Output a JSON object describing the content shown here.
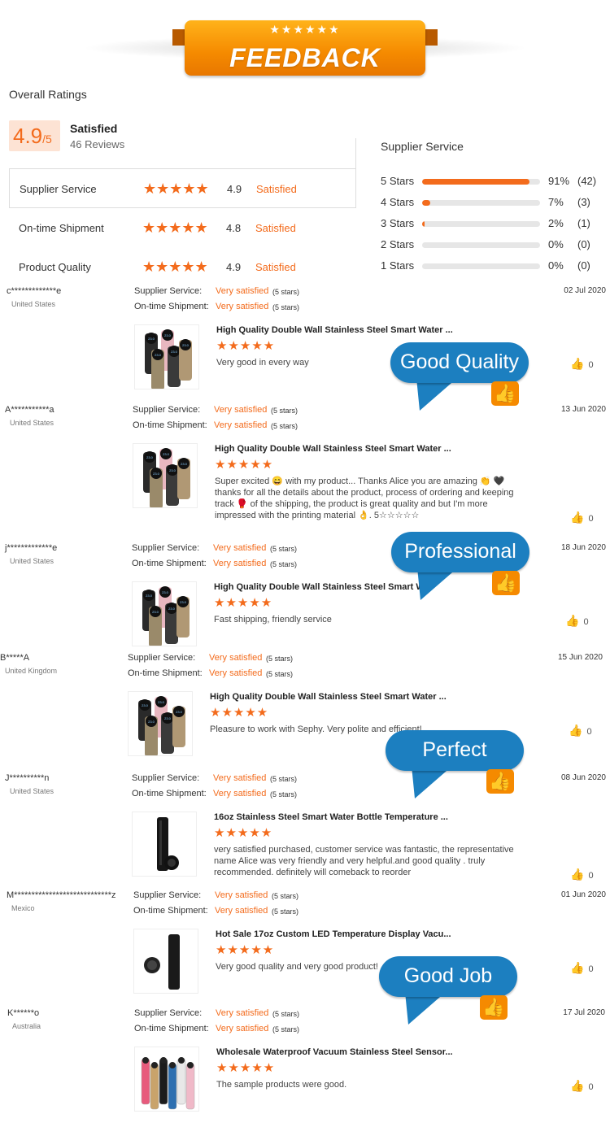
{
  "banner": {
    "stars": "★★★★★★",
    "title": "FEEDBACK"
  },
  "overall": {
    "label": "Overall Ratings",
    "score": "4.9",
    "score_suffix": "/5",
    "status": "Satisfied",
    "reviews": "46 Reviews",
    "categories": [
      {
        "name": "Supplier Service",
        "stars": "★★★★★",
        "score": "4.9",
        "status": "Satisfied"
      },
      {
        "name": "On-time Shipment",
        "stars": "★★★★★",
        "score": "4.8",
        "status": "Satisfied"
      },
      {
        "name": "Product Quality",
        "stars": "★★★★★",
        "score": "4.9",
        "status": "Satisfied"
      }
    ]
  },
  "supplier_dist": {
    "title": "Supplier Service",
    "rows": [
      {
        "label": "5  Stars",
        "fraction": 0.91,
        "pct": "91%",
        "count": "(42)"
      },
      {
        "label": "4  Stars",
        "fraction": 0.07,
        "pct": "7%",
        "count": "(3)"
      },
      {
        "label": "3  Stars",
        "fraction": 0.02,
        "pct": "2%",
        "count": "(1)"
      },
      {
        "label": "2  Stars",
        "fraction": 0.0,
        "pct": "0%",
        "count": "(0)"
      },
      {
        "label": "1  Stars",
        "fraction": 0.0,
        "pct": "0%",
        "count": "(0)"
      }
    ]
  },
  "review_labels": {
    "supplier": "Supplier Service:",
    "shipment": "On-time Shipment:",
    "very_satisfied": "Very satisfied",
    "five_stars": "(5 stars)",
    "stars": "★★★★★",
    "thumb": "👍"
  },
  "reviews": [
    {
      "name": "c*************e",
      "country": "United States",
      "date": "02 Jul 2020",
      "title": "High Quality Double Wall Stainless Steel Smart Water ...",
      "text": "Very good in every way",
      "likes": "0"
    },
    {
      "name": "A***********a",
      "country": "United States",
      "date": "13 Jun 2020",
      "title": "High Quality Double Wall Stainless Steel Smart Water ...",
      "text": "Super excited 😄 with my product... Thanks Alice you are amazing 👏 🖤  thanks for all the details about the product, process of ordering and keeping track 🥊  of the shipping,  the product is great quality and but I'm more impressed with the printing material 👌.  5☆☆☆☆☆",
      "likes": "0"
    },
    {
      "name": "j*************e",
      "country": "United States",
      "date": "18 Jun 2020",
      "title": "High Quality Double Wall Stainless Steel Smart W",
      "text": "Fast shipping, friendly service",
      "likes": "0"
    },
    {
      "name": "B*****A",
      "country": "United Kingdom",
      "date": "15 Jun 2020",
      "title": "High Quality Double Wall Stainless Steel Smart Water ...",
      "text": "Pleasure to work with Sephy. Very polite and efficient!",
      "likes": "0"
    },
    {
      "name": "J**********n",
      "country": "United States",
      "date": "08 Jun 2020",
      "title": "16oz Stainless Steel Smart Water Bottle Temperature ...",
      "text": "very satisfied purchased, customer service was fantastic, the representative name Alice was very friendly and very helpful.and good quality . truly recommended. definitely will comeback to reorder",
      "likes": "0"
    },
    {
      "name": "M****************************z",
      "country": "Mexico",
      "date": "01 Jun 2020",
      "title": "Hot Sale 17oz Custom LED Temperature Display Vacu...",
      "text": "Very good quality and very good product!",
      "likes": "0"
    },
    {
      "name": "K******o",
      "country": "Australia",
      "date": "17 Jul 2020",
      "title": "Wholesale Waterproof Vacuum Stainless Steel Sensor...",
      "text": "The sample products were good.",
      "likes": "0"
    }
  ],
  "callouts": [
    "Good Quality",
    "Professional",
    "Perfect",
    "Good Job"
  ],
  "colors": {
    "accent": "#f36b1c",
    "callout": "#1c7fc0",
    "banner": "#f58a00"
  }
}
